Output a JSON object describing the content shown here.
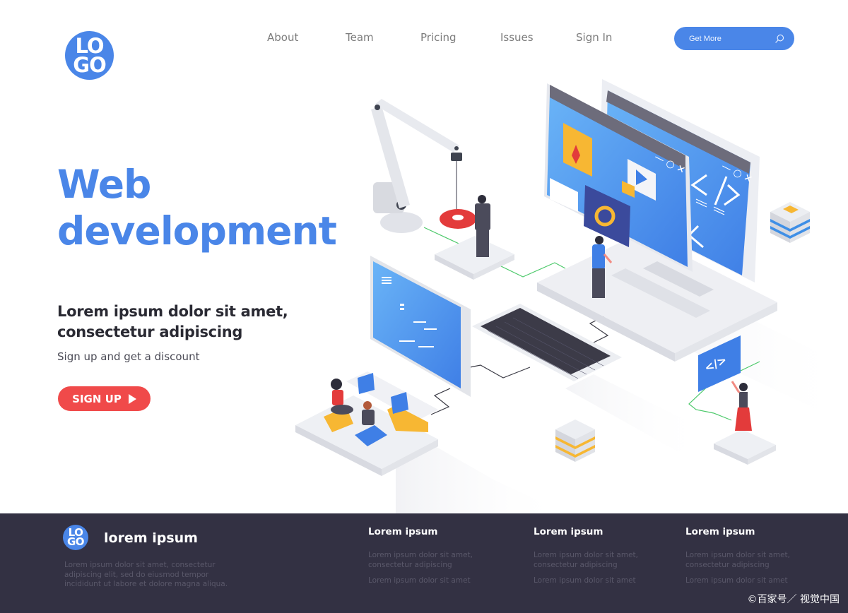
{
  "header": {
    "logo_top": "LO",
    "logo_bottom": "GO",
    "nav": [
      "About",
      "Team",
      "Pricing",
      "Issues",
      "Sign In"
    ],
    "search_label": "Get More",
    "search_icon": "search-icon"
  },
  "hero": {
    "title_line1": "Web",
    "title_line2": "development",
    "subtitle_line1": "Lorem ipsum dolor sit amet,",
    "subtitle_line2": "consectetur adipiscing",
    "description": "Sign up and get a discount",
    "cta_label": "SIGN UP",
    "cta_icon": "play-triangle-icon"
  },
  "illustration": {
    "window_controls": "— ○ ✕",
    "code_glyph": "</>"
  },
  "footer": {
    "logo_top": "LO",
    "logo_bottom": "GO",
    "brand": "lorem ipsum",
    "about": "Lorem ipsum dolor sit amet, consectetur adipiscing elit, sed do eiusmod tempor incididunt ut labore et dolore magna aliqua.",
    "columns": [
      {
        "title": "Lorem ipsum",
        "links": [
          "Lorem ipsum dolor sit amet, consectetur adipiscing",
          "Lorem ipsum dolor sit amet"
        ]
      },
      {
        "title": "Lorem ipsum",
        "links": [
          "Lorem ipsum dolor sit amet, consectetur adipiscing",
          "Lorem ipsum dolor sit amet"
        ]
      },
      {
        "title": "Lorem ipsum",
        "links": [
          "Lorem ipsum dolor sit amet, consectetur adipiscing",
          "Lorem ipsum dolor sit amet"
        ]
      }
    ],
    "watermark": "©百家号／ 视觉中国"
  },
  "colors": {
    "accent": "#4a86e8",
    "cta": "#f04a4a",
    "footer_bg": "#333143",
    "heading": "#2a2a33"
  }
}
